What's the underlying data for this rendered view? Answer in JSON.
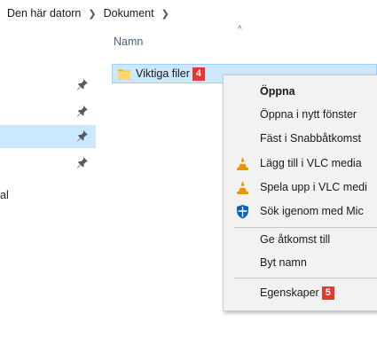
{
  "breadcrumb": [
    "Den här datorn",
    "Dokument"
  ],
  "nav": {
    "partial_label": "al"
  },
  "column": {
    "name_header": "Namn",
    "sort_arrow": "^"
  },
  "file": {
    "name": "Viktiga filer",
    "badge": "4"
  },
  "context_menu": {
    "items": [
      {
        "label": "Öppna"
      },
      {
        "label": "Öppna i nytt fönster"
      },
      {
        "label": "Fäst i Snabbåtkomst"
      },
      {
        "label": "Lägg till i VLC media",
        "icon": "vlc-icon"
      },
      {
        "label": "Spela upp i VLC medi",
        "icon": "vlc-icon"
      },
      {
        "label": "Sök igenom med Mic",
        "icon": "defender-shield-icon"
      },
      {
        "label": "Ge åtkomst till"
      },
      {
        "label": "Byt namn"
      },
      {
        "label": "Egenskaper",
        "badge": "5"
      }
    ]
  },
  "colors": {
    "selection": "#cce8ff",
    "selection_border": "#99d1ff",
    "badge": "#e8372c",
    "menu_bg": "#f2f2f2",
    "vlc_orange": "#f39200",
    "defender_blue": "#0a63b5"
  }
}
